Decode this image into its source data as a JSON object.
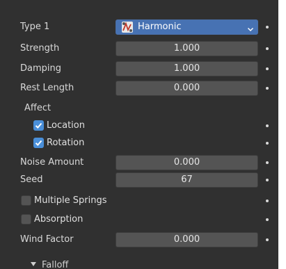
{
  "type1": {
    "label": "Type 1",
    "value": "Harmonic",
    "icon": "harmonic-spring-icon"
  },
  "strength": {
    "label": "Strength",
    "value": "1.000"
  },
  "damping": {
    "label": "Damping",
    "value": "1.000"
  },
  "rest_length": {
    "label": "Rest Length",
    "value": "0.000"
  },
  "affect": {
    "label": "Affect",
    "location": {
      "label": "Location",
      "checked": true
    },
    "rotation": {
      "label": "Rotation",
      "checked": true
    }
  },
  "noise_amount": {
    "label": "Noise Amount",
    "value": "0.000"
  },
  "seed": {
    "label": "Seed",
    "value": "67"
  },
  "multiple_springs": {
    "label": "Multiple Springs",
    "checked": false
  },
  "absorption": {
    "label": "Absorption",
    "checked": false
  },
  "wind_factor": {
    "label": "Wind Factor",
    "value": "0.000"
  },
  "falloff": {
    "label": "Falloff",
    "expanded": false
  },
  "colors": {
    "panel_bg": "#303030",
    "field_bg": "#545454",
    "dropdown_bg": "#4772b3",
    "checkbox_on": "#4a8fd9",
    "text": "#d9d9d9"
  }
}
